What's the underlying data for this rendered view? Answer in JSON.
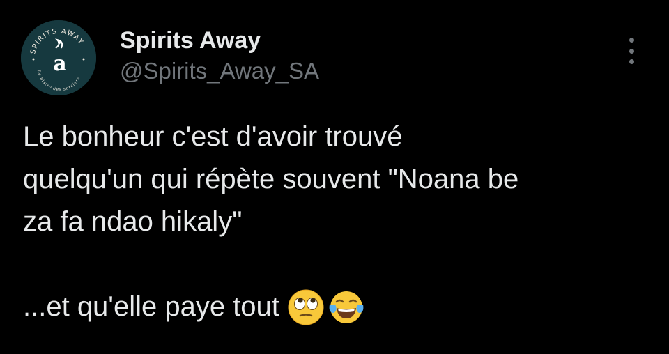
{
  "author": {
    "display_name": "Spirits Away",
    "handle": "@Spirits_Away_SA",
    "avatar_logo_text": "SPIRITS AWAY",
    "avatar_tagline": "Le bistro des sorciers",
    "avatar_letter": "a"
  },
  "tweet": {
    "lines": [
      "Le bonheur c'est d'avoir trouvé",
      "quelqu'un qui répète souvent \"Noana be",
      "za fa ndao hikaly\""
    ],
    "last_line": "...et qu'elle paye tout",
    "emojis": [
      "eye-roll-emoji",
      "tears-of-joy-emoji"
    ]
  },
  "icons": {
    "menu": "more-vertical-icon"
  },
  "colors": {
    "background": "#000000",
    "primary_text": "#e7e9ea",
    "secondary_text": "#71767b",
    "avatar_bg": "#16393f"
  }
}
